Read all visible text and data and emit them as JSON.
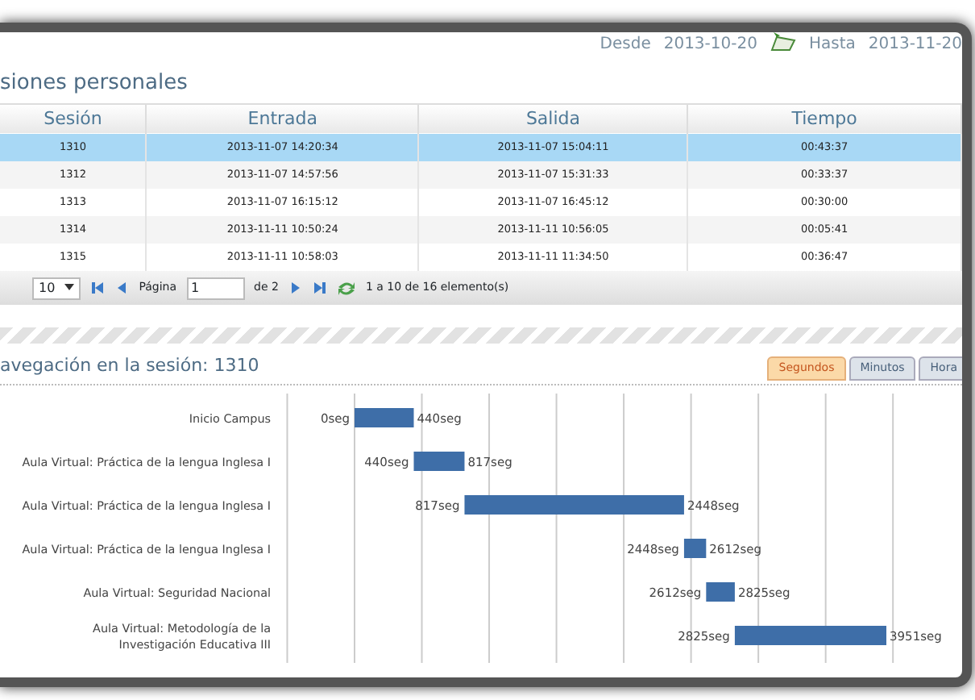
{
  "filter": {
    "from_label": "Desde",
    "from_value": "2013-10-20",
    "to_label": "Hasta",
    "to_value": "2013-11-20"
  },
  "sessions": {
    "title": "siones personales",
    "columns": [
      "Sesión",
      "Entrada",
      "Salida",
      "Tiempo"
    ],
    "rows": [
      {
        "cells": [
          "1310",
          "2013-11-07 14:20:34",
          "2013-11-07 15:04:11",
          "00:43:37"
        ],
        "selected": true
      },
      {
        "cells": [
          "1312",
          "2013-11-07 14:57:56",
          "2013-11-07 15:31:33",
          "00:33:37"
        ],
        "selected": false
      },
      {
        "cells": [
          "1313",
          "2013-11-07 16:15:12",
          "2013-11-07 16:45:12",
          "00:30:00"
        ],
        "selected": false
      },
      {
        "cells": [
          "1314",
          "2013-11-11 10:50:24",
          "2013-11-11 10:56:05",
          "00:05:41"
        ],
        "selected": false
      },
      {
        "cells": [
          "1315",
          "2013-11-11 10:58:03",
          "2013-11-11 11:34:50",
          "00:36:47"
        ],
        "selected": false
      }
    ],
    "pager": {
      "page_size": "10",
      "page_label": "Página",
      "page": "1",
      "of": "de 2",
      "summary": "1 a 10 de 16 elemento(s)"
    }
  },
  "navigation": {
    "title": "avegación en la sesión: 1310",
    "tabs": [
      {
        "label": "Segundos",
        "selected": true
      },
      {
        "label": "Minutos",
        "selected": false
      },
      {
        "label": "Hora",
        "selected": false
      }
    ],
    "rows": [
      {
        "label": "Inicio Campus",
        "start": "0seg",
        "end": "440seg"
      },
      {
        "label": "Aula Virtual: Práctica de la lengua Inglesa I",
        "start": "440seg",
        "end": "817seg"
      },
      {
        "label": "Aula Virtual: Práctica de la lengua Inglesa I",
        "start": "817seg",
        "end": "2448seg"
      },
      {
        "label": "Aula Virtual: Práctica de la lengua Inglesa I",
        "start": "2448seg",
        "end": "2612seg"
      },
      {
        "label": "Aula Virtual: Seguridad Nacional",
        "start": "2612seg",
        "end": "2825seg"
      },
      {
        "label": "Aula Virtual: Metodología de la Investigación Educativa III",
        "start": "2825seg",
        "end": "3951seg"
      }
    ]
  }
}
